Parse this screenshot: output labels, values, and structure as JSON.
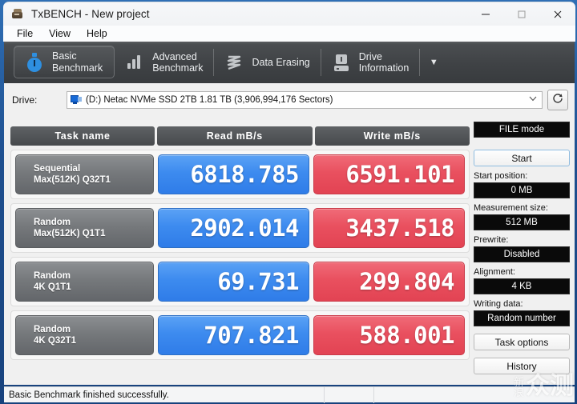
{
  "window": {
    "title": "TxBENCH - New project",
    "icon": "app-icon",
    "controls": {
      "minimize": "—",
      "maximize": "□",
      "close": "✕"
    }
  },
  "menu": {
    "items": [
      "File",
      "View",
      "Help"
    ]
  },
  "tabs": [
    {
      "label": "Basic\nBenchmark",
      "icon": "stopwatch-icon",
      "active": true
    },
    {
      "label": "Advanced\nBenchmark",
      "icon": "bar-chart-icon",
      "active": false
    },
    {
      "label": "Data Erasing",
      "icon": "eraser-icon",
      "active": false
    },
    {
      "label": "Drive\nInformation",
      "icon": "hard-drive-icon",
      "active": false
    }
  ],
  "ribbon_more": "▼",
  "drive": {
    "label": "Drive:",
    "selected": "(D:) Netac NVMe SSD 2TB  1.81 TB (3,906,994,176 Sectors)",
    "arrow": "⌄",
    "refresh_icon": "refresh-icon"
  },
  "table": {
    "headers": [
      "Task name",
      "Read mB/s",
      "Write mB/s"
    ],
    "rows": [
      {
        "task": "Sequential\nMax(512K) Q32T1",
        "read": "6818.785",
        "write": "6591.101"
      },
      {
        "task": "Random\nMax(512K) Q1T1",
        "read": "2902.014",
        "write": "3437.518"
      },
      {
        "task": "Random\n4K Q1T1",
        "read": "69.731",
        "write": "299.804"
      },
      {
        "task": "Random\n4K Q32T1",
        "read": "707.821",
        "write": "588.001"
      }
    ]
  },
  "side": {
    "mode_button": "FILE mode",
    "start_button": "Start",
    "start_position_label": "Start position:",
    "start_position_value": "0 MB",
    "measurement_size_label": "Measurement size:",
    "measurement_size_value": "512 MB",
    "prewrite_label": "Prewrite:",
    "prewrite_value": "Disabled",
    "alignment_label": "Alignment:",
    "alignment_value": "4 KB",
    "writing_data_label": "Writing data:",
    "writing_data_value": "Random number",
    "task_options_button": "Task options",
    "history_button": "History"
  },
  "statusbar": {
    "message": "Basic Benchmark finished successfully.",
    "cell2": "",
    "cell3": ""
  },
  "watermark": {
    "line1": "新",
    "line2": "浪",
    "big": "众测"
  },
  "colors": {
    "read": "#3d8bef",
    "write": "#e9505f",
    "task": "#76797c",
    "header": "#4f5255",
    "accent_blue": "#2e8fe0"
  }
}
